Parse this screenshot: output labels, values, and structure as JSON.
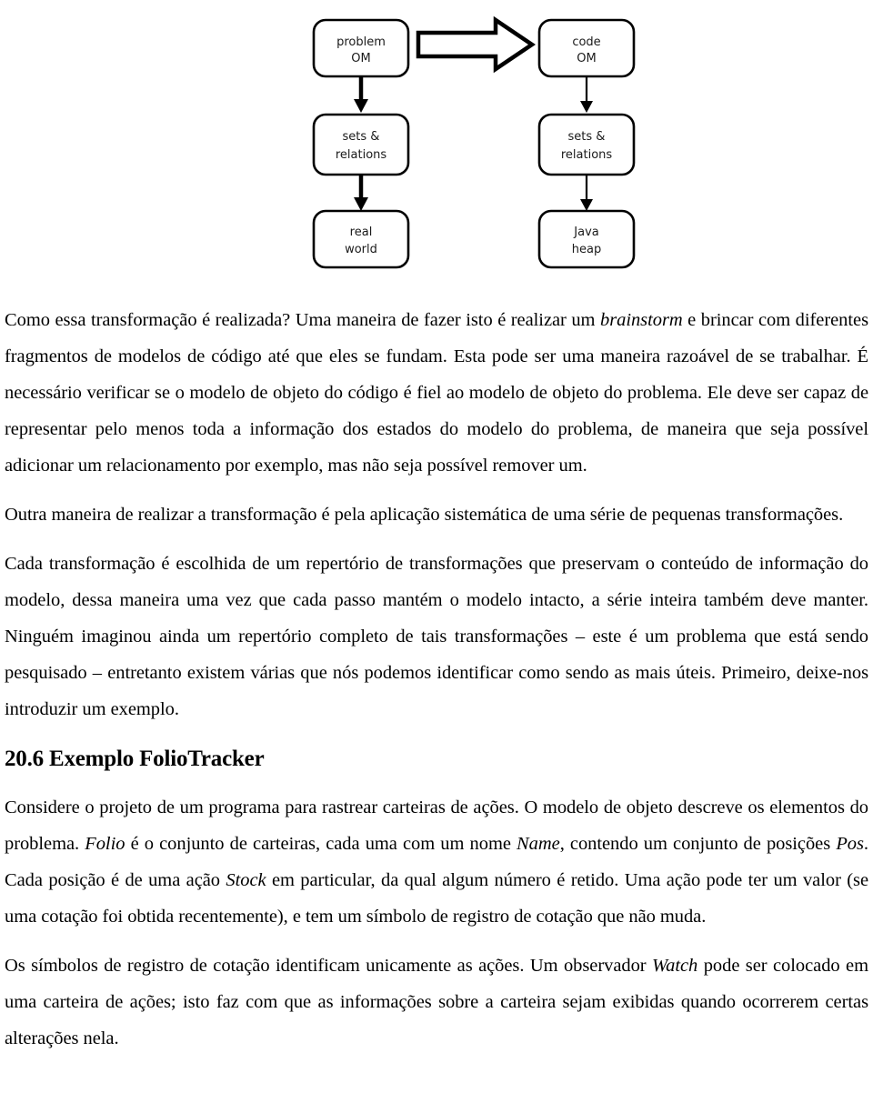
{
  "figure": {
    "name": "object-model-transformation-diagram",
    "nodes": {
      "problem_om_line1": "problem",
      "problem_om_line2": "OM",
      "code_om_line1": "code",
      "code_om_line2": "OM",
      "left_sets_line1": "sets &",
      "left_sets_line2": "relations",
      "right_sets_line1": "sets &",
      "right_sets_line2": "relations",
      "real_world_line1": "real",
      "real_world_line2": "world",
      "java_heap_line1": "Java",
      "java_heap_line2": "heap"
    },
    "colors": {
      "stroke": "#000000",
      "fill": "#ffffff",
      "text": "#1a1a1a"
    }
  },
  "document": {
    "paragraphs": [
      {
        "id": "para-transformacao",
        "runs": [
          {
            "text": "Como essa transformação é realizada? Uma maneira de fazer isto é realizar um ",
            "style": "normal"
          },
          {
            "text": "brainstorm",
            "style": "italic"
          },
          {
            "text": " e brincar com diferentes fragmentos de modelos de código até que eles se fundam. Esta pode ser uma maneira razoável de se trabalhar. É necessário verificar se o modelo de objeto do código é fiel ao modelo de objeto do problema. Ele deve ser capaz de representar pelo menos toda a informação dos estados do modelo do problema, de maneira que seja possível adicionar um relacionamento por exemplo, mas não seja possível remover um.",
            "style": "normal"
          }
        ]
      },
      {
        "id": "para-outra-maneira",
        "runs": [
          {
            "text": "Outra maneira de realizar a transformação é pela aplicação sistemática de uma série de pequenas transformações.",
            "style": "normal"
          }
        ]
      },
      {
        "id": "para-cada-transformacao",
        "runs": [
          {
            "text": "Cada transformação é escolhida de um repertório de transformações que preservam o conteúdo de informação do modelo, dessa maneira uma vez que cada passo mantém o modelo intacto, a série inteira também deve manter. Ninguém imaginou ainda um repertório completo de tais transformações – este é um problema que está sendo pesquisado – entretanto existem várias que nós podemos identificar como sendo as mais úteis. Primeiro, deixe-nos introduzir um exemplo.",
            "style": "normal"
          }
        ]
      }
    ],
    "heading": "20.6 Exemplo FolioTracker",
    "paragraphs_after_heading": [
      {
        "id": "para-considere-projeto",
        "runs": [
          {
            "text": "Considere o projeto de um programa para rastrear carteiras de ações. O modelo de objeto descreve os elementos do problema. ",
            "style": "normal"
          },
          {
            "text": "Folio",
            "style": "italic"
          },
          {
            "text": " é o conjunto de carteiras, cada uma com um nome ",
            "style": "normal"
          },
          {
            "text": "Name",
            "style": "italic"
          },
          {
            "text": ", contendo um conjunto de posições ",
            "style": "normal"
          },
          {
            "text": "Pos",
            "style": "italic"
          },
          {
            "text": ". Cada posição é de uma ação ",
            "style": "normal"
          },
          {
            "text": "Stock",
            "style": "italic"
          },
          {
            "text": " em particular, da qual algum número é retido. Uma ação pode ter um valor (se uma cotação foi obtida recentemente), e tem um símbolo de registro de cotação que não muda.",
            "style": "normal"
          }
        ]
      },
      {
        "id": "para-simbolos-registro",
        "runs": [
          {
            "text": "Os símbolos de registro de cotação identificam unicamente as ações. Um observador ",
            "style": "normal"
          },
          {
            "text": "Watch",
            "style": "italic"
          },
          {
            "text": " pode ser colocado em uma carteira de ações; isto faz com que as informações sobre a carteira sejam exibidas quando ocorrerem certas alterações nela.",
            "style": "normal"
          }
        ]
      }
    ]
  }
}
